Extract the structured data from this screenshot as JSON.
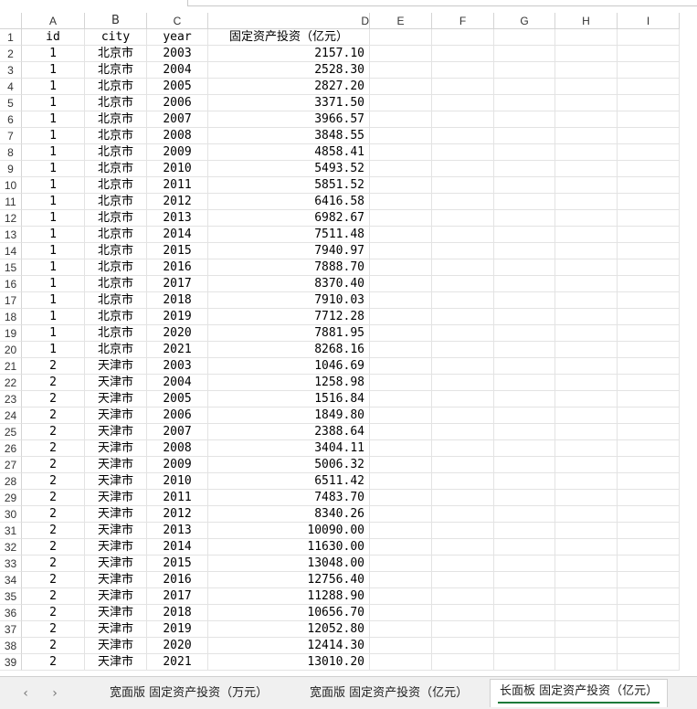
{
  "columns": [
    "A",
    "B",
    "C",
    "D",
    "E",
    "F",
    "G",
    "H",
    "I"
  ],
  "header": {
    "id": "id",
    "city": "city",
    "year": "year",
    "value": "固定资产投资（亿元）"
  },
  "rows": [
    [
      "1",
      "北京市",
      "2003",
      "2157.10"
    ],
    [
      "1",
      "北京市",
      "2004",
      "2528.30"
    ],
    [
      "1",
      "北京市",
      "2005",
      "2827.20"
    ],
    [
      "1",
      "北京市",
      "2006",
      "3371.50"
    ],
    [
      "1",
      "北京市",
      "2007",
      "3966.57"
    ],
    [
      "1",
      "北京市",
      "2008",
      "3848.55"
    ],
    [
      "1",
      "北京市",
      "2009",
      "4858.41"
    ],
    [
      "1",
      "北京市",
      "2010",
      "5493.52"
    ],
    [
      "1",
      "北京市",
      "2011",
      "5851.52"
    ],
    [
      "1",
      "北京市",
      "2012",
      "6416.58"
    ],
    [
      "1",
      "北京市",
      "2013",
      "6982.67"
    ],
    [
      "1",
      "北京市",
      "2014",
      "7511.48"
    ],
    [
      "1",
      "北京市",
      "2015",
      "7940.97"
    ],
    [
      "1",
      "北京市",
      "2016",
      "7888.70"
    ],
    [
      "1",
      "北京市",
      "2017",
      "8370.40"
    ],
    [
      "1",
      "北京市",
      "2018",
      "7910.03"
    ],
    [
      "1",
      "北京市",
      "2019",
      "7712.28"
    ],
    [
      "1",
      "北京市",
      "2020",
      "7881.95"
    ],
    [
      "1",
      "北京市",
      "2021",
      "8268.16"
    ],
    [
      "2",
      "天津市",
      "2003",
      "1046.69"
    ],
    [
      "2",
      "天津市",
      "2004",
      "1258.98"
    ],
    [
      "2",
      "天津市",
      "2005",
      "1516.84"
    ],
    [
      "2",
      "天津市",
      "2006",
      "1849.80"
    ],
    [
      "2",
      "天津市",
      "2007",
      "2388.64"
    ],
    [
      "2",
      "天津市",
      "2008",
      "3404.11"
    ],
    [
      "2",
      "天津市",
      "2009",
      "5006.32"
    ],
    [
      "2",
      "天津市",
      "2010",
      "6511.42"
    ],
    [
      "2",
      "天津市",
      "2011",
      "7483.70"
    ],
    [
      "2",
      "天津市",
      "2012",
      "8340.26"
    ],
    [
      "2",
      "天津市",
      "2013",
      "10090.00"
    ],
    [
      "2",
      "天津市",
      "2014",
      "11630.00"
    ],
    [
      "2",
      "天津市",
      "2015",
      "13048.00"
    ],
    [
      "2",
      "天津市",
      "2016",
      "12756.40"
    ],
    [
      "2",
      "天津市",
      "2017",
      "11288.90"
    ],
    [
      "2",
      "天津市",
      "2018",
      "10656.70"
    ],
    [
      "2",
      "天津市",
      "2019",
      "12052.80"
    ],
    [
      "2",
      "天津市",
      "2020",
      "12414.30"
    ],
    [
      "2",
      "天津市",
      "2021",
      "13010.20"
    ]
  ],
  "tabs": [
    {
      "label": "宽面版 固定资产投资（万元）",
      "active": false
    },
    {
      "label": "宽面版 固定资产投资（亿元）",
      "active": false
    },
    {
      "label": "长面板 固定资产投资（亿元）",
      "active": true
    }
  ],
  "nav": {
    "prev": "‹",
    "next": "›"
  },
  "colors": {
    "active_tab_underline": "#1a7a3a",
    "gridline": "#e3e3e3"
  }
}
